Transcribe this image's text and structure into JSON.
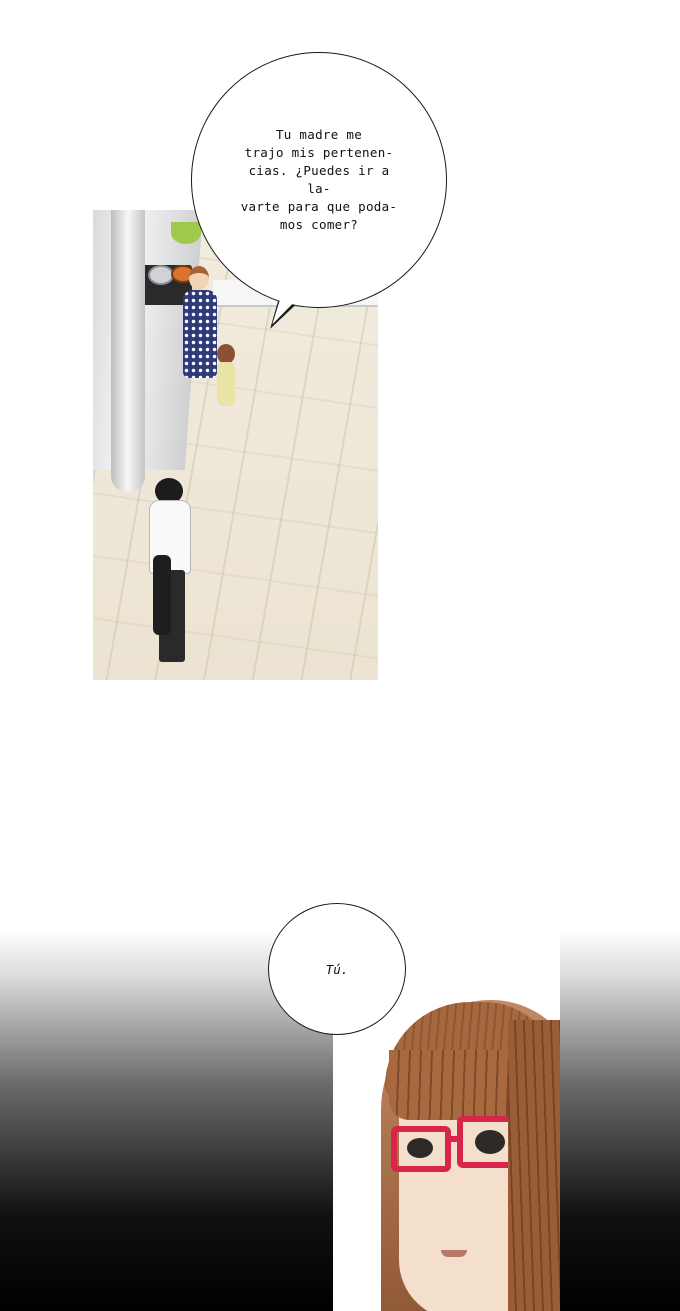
{
  "speech_bubbles": {
    "bubble_1": {
      "text": "Tu madre me\ntrajo mis pertenen-\ncias. ¿Puedes ir a la-\nvarte para que poda-\nmos comer?"
    },
    "bubble_2": {
      "text": "Tú."
    }
  },
  "colors": {
    "background": "#ffffff",
    "glasses": "#d8264a",
    "hair": "#a6683f",
    "gradient_dark": "#000000"
  }
}
